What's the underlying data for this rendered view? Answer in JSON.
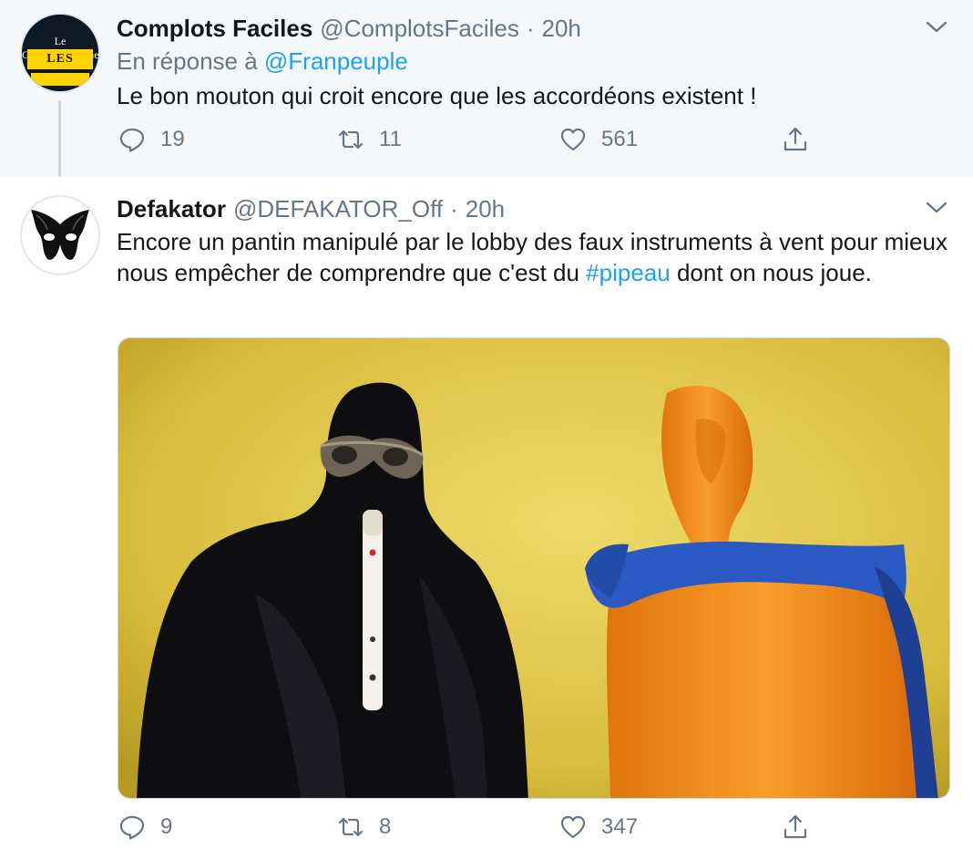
{
  "tweets": [
    {
      "name": "Complots Faciles",
      "handle": "@ComplotsFaciles",
      "separator": "·",
      "time": "20h",
      "reply_prefix": "En réponse à",
      "reply_mention": "@Franpeuple",
      "text": "Le bon mouton qui croit encore que les accordéons existent !",
      "avatar": {
        "title_line": "Le Conspirationisme",
        "band_line": "LES NULS"
      },
      "stats": {
        "replies": "19",
        "retweets": "11",
        "likes": "561"
      }
    },
    {
      "name": "Defakator",
      "handle": "@DEFAKATOR_Off",
      "separator": "·",
      "time": "20h",
      "text_before": "Encore un pantin manipulé par le lobby des faux instruments à vent pour mieux nous empêcher de comprendre que c'est du ",
      "hashtag": "#pipeau",
      "text_after": " dont on nous joue.",
      "stats": {
        "replies": "9",
        "retweets": "8",
        "likes": "347"
      }
    }
  ],
  "icons": {
    "reply": "reply-icon",
    "retweet": "retweet-icon",
    "like": "heart-icon",
    "share": "share-icon",
    "more": "chevron-down-icon"
  },
  "colors": {
    "accent": "#1da1f2",
    "muted": "#657786",
    "reply_bg": "#f5f8fa",
    "media_wall": "#e2c84a",
    "costume_orange": "#f7931e",
    "costume_blue": "#2b59c3"
  }
}
